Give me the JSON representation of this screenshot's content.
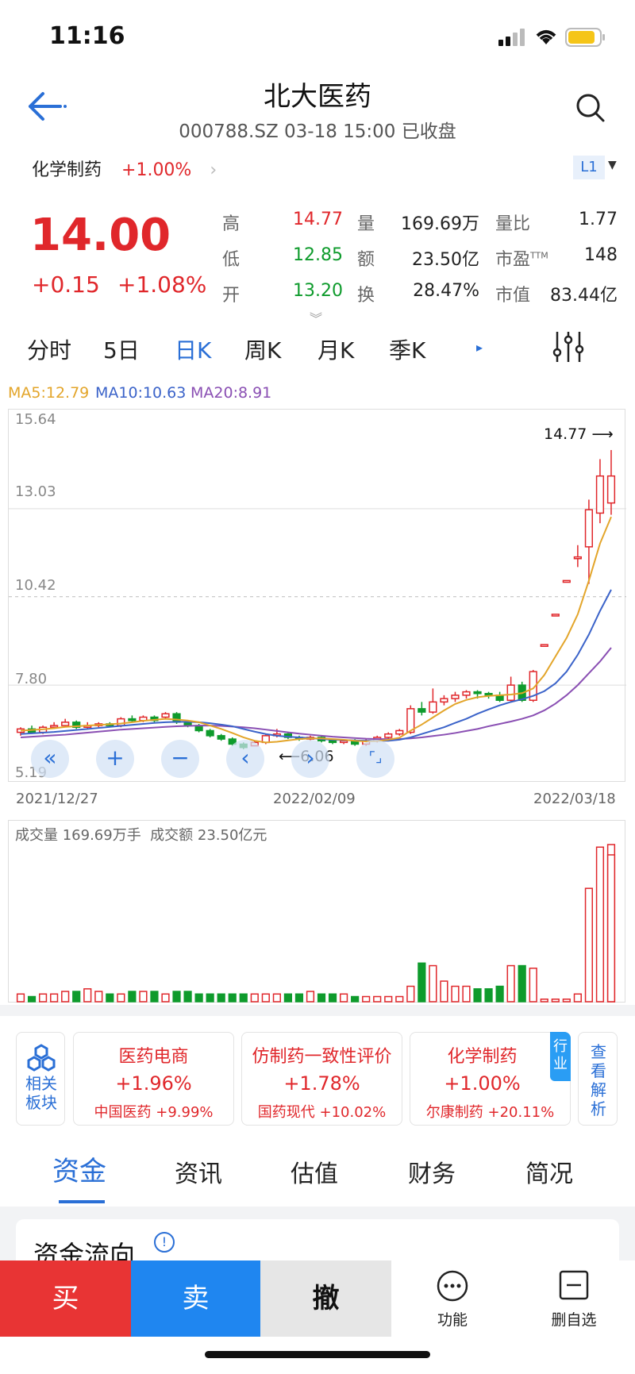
{
  "status": {
    "time": "11:16"
  },
  "header": {
    "title": "北大医药",
    "subtitle": "000788.SZ 03-18 15:00 已收盘"
  },
  "sector": {
    "name": "化学制药",
    "change": "+1.00%",
    "level": "L1"
  },
  "quote": {
    "price": "14.00",
    "change": "+0.15",
    "change_pct": "+1.08%",
    "rows": [
      [
        {
          "label": "高",
          "value": "14.77",
          "color": "red"
        },
        {
          "label": "量",
          "value": "169.69万"
        },
        {
          "label": "量比",
          "value": "1.77"
        }
      ],
      [
        {
          "label": "低",
          "value": "12.85",
          "color": "green"
        },
        {
          "label": "额",
          "value": "23.50亿"
        },
        {
          "label": "市盈TTM",
          "value": "148"
        }
      ],
      [
        {
          "label": "开",
          "value": "13.20",
          "color": "green"
        },
        {
          "label": "换",
          "value": "28.47%"
        },
        {
          "label": "市值",
          "value": "83.44亿"
        }
      ]
    ]
  },
  "period_tabs": [
    "分时",
    "5日",
    "日K",
    "周K",
    "月K",
    "季K"
  ],
  "active_period": "日K",
  "ma": {
    "ma5": "MA5:12.79",
    "ma10": "MA10:10.63",
    "ma20": "MA20:8.91"
  },
  "colors": {
    "up": "#e0272b",
    "down": "#0e9b2c",
    "ma5": "#e3a52a",
    "ma10": "#3b63c9",
    "ma20": "#8a4fb3",
    "accent": "#2a6fd6"
  },
  "chart_data": {
    "type": "candlestick",
    "y_ticks": [
      "15.64",
      "13.03",
      "10.42",
      "7.80",
      "5.19"
    ],
    "x_ticks": [
      "2021/12/27",
      "2022/02/09",
      "2022/03/18"
    ],
    "ylim": [
      5.19,
      15.64
    ],
    "max_label": "14.77",
    "min_label": "6.06",
    "candles": [
      {
        "o": 6.4,
        "c": 6.5,
        "h": 6.55,
        "l": 6.3
      },
      {
        "o": 6.5,
        "c": 6.4,
        "h": 6.6,
        "l": 6.35
      },
      {
        "o": 6.4,
        "c": 6.55,
        "h": 6.6,
        "l": 6.35
      },
      {
        "o": 6.55,
        "c": 6.6,
        "h": 6.7,
        "l": 6.5
      },
      {
        "o": 6.6,
        "c": 6.7,
        "h": 6.8,
        "l": 6.55
      },
      {
        "o": 6.7,
        "c": 6.55,
        "h": 6.75,
        "l": 6.5
      },
      {
        "o": 6.55,
        "c": 6.6,
        "h": 6.7,
        "l": 6.5
      },
      {
        "o": 6.6,
        "c": 6.65,
        "h": 6.7,
        "l": 6.55
      },
      {
        "o": 6.65,
        "c": 6.6,
        "h": 6.7,
        "l": 6.55
      },
      {
        "o": 6.6,
        "c": 6.8,
        "h": 6.85,
        "l": 6.55
      },
      {
        "o": 6.8,
        "c": 6.75,
        "h": 6.9,
        "l": 6.7
      },
      {
        "o": 6.75,
        "c": 6.85,
        "h": 6.9,
        "l": 6.7
      },
      {
        "o": 6.85,
        "c": 6.75,
        "h": 6.9,
        "l": 6.7
      },
      {
        "o": 6.85,
        "c": 6.95,
        "h": 7.0,
        "l": 6.8
      },
      {
        "o": 6.95,
        "c": 6.7,
        "h": 7.0,
        "l": 6.65
      },
      {
        "o": 6.7,
        "c": 6.6,
        "h": 6.75,
        "l": 6.55
      },
      {
        "o": 6.6,
        "c": 6.45,
        "h": 6.65,
        "l": 6.4
      },
      {
        "o": 6.45,
        "c": 6.3,
        "h": 6.5,
        "l": 6.25
      },
      {
        "o": 6.3,
        "c": 6.2,
        "h": 6.35,
        "l": 6.15
      },
      {
        "o": 6.2,
        "c": 6.05,
        "h": 6.25,
        "l": 6.0
      },
      {
        "o": 6.05,
        "c": 5.95,
        "h": 6.1,
        "l": 5.9
      },
      {
        "o": 6.0,
        "c": 6.1,
        "h": 6.15,
        "l": 6.06
      },
      {
        "o": 6.1,
        "c": 6.3,
        "h": 6.35,
        "l": 6.05
      },
      {
        "o": 6.3,
        "c": 6.35,
        "h": 6.5,
        "l": 6.25
      },
      {
        "o": 6.35,
        "c": 6.25,
        "h": 6.4,
        "l": 6.2
      },
      {
        "o": 6.25,
        "c": 6.2,
        "h": 6.3,
        "l": 6.15
      },
      {
        "o": 6.2,
        "c": 6.25,
        "h": 6.3,
        "l": 6.15
      },
      {
        "o": 6.25,
        "c": 6.15,
        "h": 6.3,
        "l": 6.1
      },
      {
        "o": 6.15,
        "c": 6.1,
        "h": 6.2,
        "l": 6.05
      },
      {
        "o": 6.1,
        "c": 6.15,
        "h": 6.2,
        "l": 6.05
      },
      {
        "o": 6.15,
        "c": 6.05,
        "h": 6.2,
        "l": 6.0
      },
      {
        "o": 6.05,
        "c": 6.15,
        "h": 6.2,
        "l": 6.0
      },
      {
        "o": 6.15,
        "c": 6.25,
        "h": 6.3,
        "l": 6.1
      },
      {
        "o": 6.25,
        "c": 6.35,
        "h": 6.4,
        "l": 6.2
      },
      {
        "o": 6.35,
        "c": 6.45,
        "h": 6.5,
        "l": 6.3
      },
      {
        "o": 6.4,
        "c": 7.1,
        "h": 7.2,
        "l": 6.35
      },
      {
        "o": 7.1,
        "c": 7.0,
        "h": 7.3,
        "l": 6.9
      },
      {
        "o": 7.0,
        "c": 7.3,
        "h": 7.7,
        "l": 6.95
      },
      {
        "o": 7.3,
        "c": 7.4,
        "h": 7.5,
        "l": 7.2
      },
      {
        "o": 7.4,
        "c": 7.5,
        "h": 7.6,
        "l": 7.3
      },
      {
        "o": 7.5,
        "c": 7.6,
        "h": 7.65,
        "l": 7.4
      },
      {
        "o": 7.6,
        "c": 7.55,
        "h": 7.65,
        "l": 7.4
      },
      {
        "o": 7.55,
        "c": 7.5,
        "h": 7.6,
        "l": 7.4
      },
      {
        "o": 7.5,
        "c": 7.35,
        "h": 7.6,
        "l": 7.3
      },
      {
        "o": 7.35,
        "c": 7.8,
        "h": 8.05,
        "l": 7.3
      },
      {
        "o": 7.8,
        "c": 7.35,
        "h": 7.9,
        "l": 7.3
      },
      {
        "o": 7.35,
        "c": 8.2,
        "h": 8.25,
        "l": 7.3
      },
      {
        "o": 8.95,
        "c": 9.0,
        "h": 9.0,
        "l": 8.95
      },
      {
        "o": 9.85,
        "c": 9.9,
        "h": 9.9,
        "l": 9.85
      },
      {
        "o": 10.85,
        "c": 10.9,
        "h": 10.9,
        "l": 10.85
      },
      {
        "o": 11.55,
        "c": 11.6,
        "h": 11.95,
        "l": 11.3
      },
      {
        "o": 11.9,
        "c": 13.0,
        "h": 13.3,
        "l": 10.8
      },
      {
        "o": 12.9,
        "c": 14.0,
        "h": 14.5,
        "l": 12.6
      },
      {
        "o": 13.2,
        "c": 14.0,
        "h": 14.77,
        "l": 12.85
      }
    ],
    "ma5": [
      6.45,
      6.47,
      6.49,
      6.52,
      6.56,
      6.58,
      6.6,
      6.62,
      6.64,
      6.66,
      6.7,
      6.74,
      6.77,
      6.8,
      6.78,
      6.75,
      6.7,
      6.6,
      6.5,
      6.38,
      6.25,
      6.15,
      6.1,
      6.12,
      6.16,
      6.2,
      6.22,
      6.22,
      6.2,
      6.18,
      6.15,
      6.13,
      6.14,
      6.18,
      6.24,
      6.45,
      6.63,
      6.84,
      7.05,
      7.24,
      7.36,
      7.44,
      7.48,
      7.5,
      7.52,
      7.56,
      7.7,
      8.1,
      8.65,
      9.2,
      9.9,
      10.9,
      12.0,
      12.79
    ],
    "ma10": [
      6.35,
      6.37,
      6.39,
      6.41,
      6.44,
      6.47,
      6.5,
      6.53,
      6.56,
      6.59,
      6.62,
      6.65,
      6.68,
      6.7,
      6.71,
      6.71,
      6.7,
      6.67,
      6.63,
      6.58,
      6.5,
      6.42,
      6.35,
      6.3,
      6.27,
      6.25,
      6.23,
      6.2,
      6.18,
      6.17,
      6.16,
      6.15,
      6.15,
      6.15,
      6.18,
      6.25,
      6.35,
      6.45,
      6.55,
      6.68,
      6.8,
      6.95,
      7.08,
      7.2,
      7.3,
      7.38,
      7.48,
      7.62,
      7.85,
      8.2,
      8.7,
      9.3,
      10.0,
      10.63
    ],
    "ma20": [
      6.25,
      6.27,
      6.29,
      6.31,
      6.33,
      6.36,
      6.39,
      6.42,
      6.45,
      6.48,
      6.5,
      6.52,
      6.54,
      6.56,
      6.58,
      6.59,
      6.6,
      6.6,
      6.59,
      6.57,
      6.55,
      6.52,
      6.48,
      6.44,
      6.4,
      6.36,
      6.33,
      6.3,
      6.27,
      6.25,
      6.23,
      6.21,
      6.2,
      6.2,
      6.2,
      6.22,
      6.25,
      6.29,
      6.33,
      6.38,
      6.44,
      6.5,
      6.58,
      6.65,
      6.72,
      6.8,
      6.9,
      7.05,
      7.25,
      7.5,
      7.8,
      8.15,
      8.5,
      8.91
    ],
    "volume_label": "成交量 169.69万手",
    "amount_label": "成交额 23.50亿元",
    "volumes": [
      3,
      2,
      3,
      3,
      4,
      4,
      5,
      4,
      3,
      3,
      4,
      4,
      4,
      3,
      4,
      4,
      3,
      3,
      3,
      3,
      3,
      3,
      3,
      3,
      3,
      3,
      4,
      3,
      3,
      3,
      2,
      2,
      2,
      2,
      2,
      6,
      15,
      14,
      8,
      6,
      6,
      5,
      5,
      6,
      14,
      14,
      13,
      1,
      1,
      1,
      3,
      44,
      60,
      61,
      57
    ]
  },
  "chart_controls": [
    "«",
    "+",
    "−",
    "‹",
    "›",
    "⌜⌟"
  ],
  "related": {
    "label": "相关板块",
    "cards": [
      {
        "name": "医药电商",
        "change": "+1.96%",
        "leader": "中国医药",
        "leader_change": "+9.99%"
      },
      {
        "name": "仿制药一致性评价",
        "change": "+1.78%",
        "leader": "国药现代",
        "leader_change": "+10.02%"
      },
      {
        "name": "化学制药",
        "change": "+1.00%",
        "leader": "尔康制药",
        "leader_change": "+20.11%",
        "tag": "行业"
      }
    ],
    "more": "查看解析"
  },
  "info_tabs": [
    "资金",
    "资讯",
    "估值",
    "财务",
    "简况"
  ],
  "active_info_tab": "资金",
  "section_title": "资金流向",
  "bottom": {
    "buy": "买",
    "sell": "卖",
    "cancel": "撤",
    "func": "功能",
    "remove": "删自选"
  }
}
